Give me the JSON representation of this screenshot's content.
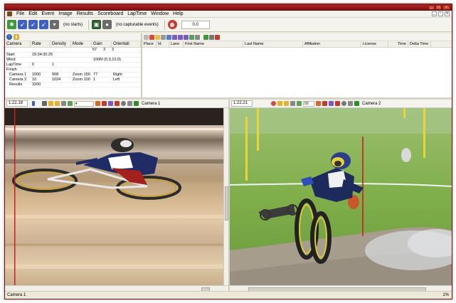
{
  "menu": [
    "File",
    "Edit",
    "Event",
    "Image",
    "Results",
    "Scoreboard",
    "LapTime",
    "Window",
    "Help"
  ],
  "toolbar": {
    "no_starts": "(no starts)",
    "no_events": "(no capturable events)",
    "value": "0.0"
  },
  "camera_table": {
    "columns": [
      "Camera",
      "Rate",
      "Density",
      "Mode",
      "Gain",
      "Orientati"
    ],
    "summary_row": [
      "",
      "",
      "",
      "",
      "57",
      "3",
      "3"
    ],
    "rows": [
      {
        "label": "Start",
        "v1": "15:34:30.25",
        "v2": "",
        "v3": "",
        "v4": "",
        "v5": ""
      },
      {
        "label": "Wind",
        "v1": "",
        "v2": "",
        "v3": "",
        "v4": "100M (0.0,10.0)",
        "v5": ""
      },
      {
        "label": "LapTime",
        "v1": "0",
        "v2": "1",
        "v3": "",
        "v4": "",
        "v5": ""
      },
      {
        "label": "Finish",
        "v1": "",
        "v2": "",
        "v3": "",
        "v4": "",
        "v5": ""
      },
      {
        "label": "Camera 1",
        "v1": "1000",
        "v2": "908",
        "v3": "Zoom 150",
        "v4": "77",
        "v5": "Right"
      },
      {
        "label": "Camera 2",
        "v1": "10",
        "v2": "1024",
        "v3": "Zoom 100",
        "v4": "1",
        "v5": "Left"
      },
      {
        "label": "Results",
        "v1": "3200",
        "v2": "",
        "v3": "",
        "v4": "",
        "v5": ""
      }
    ]
  },
  "results_table": {
    "columns": [
      "Place",
      "Id",
      "Lane",
      "First Name",
      "Last Name",
      "Affiliation",
      "License",
      "Time",
      "Delta Time"
    ]
  },
  "left_pane": {
    "time": "1:22.18",
    "camera_label": "Camera 1"
  },
  "right_pane": {
    "time": "1:22.21",
    "zoom": "50",
    "camera_label": "Camera 2"
  },
  "statusbar": {
    "text": "Camera 1",
    "zoom_pct": "1%"
  },
  "colors": {
    "title_red": "#a01c1e",
    "finish_line": "#c81e1e"
  }
}
